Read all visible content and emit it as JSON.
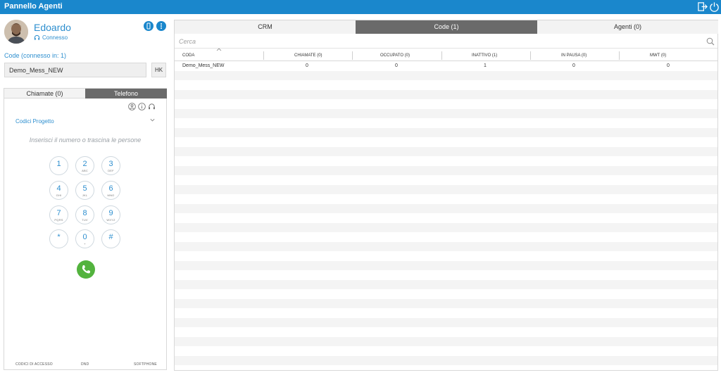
{
  "app": {
    "title": "Pannello Agenti"
  },
  "topbar": {
    "logout_icon": "logout-icon",
    "power_icon": "power-icon"
  },
  "agent": {
    "name": "Edoardo",
    "status": "Connesso"
  },
  "queues": {
    "label": "Code (connesso in: 1)",
    "value": "Demo_Mess_NEW",
    "hk_label": "HK"
  },
  "phone_tabs": [
    {
      "label": "Chiamate (0)",
      "active": false
    },
    {
      "label": "Telefono",
      "active": true
    }
  ],
  "phone": {
    "codici_label": "Codici Progetto",
    "dial_placeholder": "Inserisci il numero o trascina le persone",
    "keys": [
      {
        "num": "1",
        "sub": ""
      },
      {
        "num": "2",
        "sub": "ABC"
      },
      {
        "num": "3",
        "sub": "DEF"
      },
      {
        "num": "4",
        "sub": "GHI"
      },
      {
        "num": "5",
        "sub": "JKL"
      },
      {
        "num": "6",
        "sub": "MNO"
      },
      {
        "num": "7",
        "sub": "PQRS"
      },
      {
        "num": "8",
        "sub": "TUV"
      },
      {
        "num": "9",
        "sub": "WXYZ"
      },
      {
        "num": "*",
        "sub": ""
      },
      {
        "num": "0",
        "sub": "+"
      },
      {
        "num": "#",
        "sub": ""
      }
    ],
    "bottom_links": [
      "CODICI DI ACCESSO",
      "DND",
      "SOFTPHONE"
    ]
  },
  "right_tabs": [
    {
      "label": "CRM",
      "active": false
    },
    {
      "label": "Code (1)",
      "active": true
    },
    {
      "label": "Agenti (0)",
      "active": false
    }
  ],
  "search": {
    "placeholder": "Cerca"
  },
  "table": {
    "columns": [
      "CODA",
      "CHIAMATE (0)",
      "OCCUPATO (0)",
      "INATTIVO (1)",
      "IN PAUSA (0)",
      "MWT (0)"
    ],
    "rows": [
      [
        "Demo_Mess_NEW",
        "0",
        "0",
        "1",
        "0",
        "0"
      ]
    ]
  },
  "colors": {
    "accent": "#1a87cc",
    "active_tab": "#6a6a6a",
    "call_green": "#53b33e"
  }
}
